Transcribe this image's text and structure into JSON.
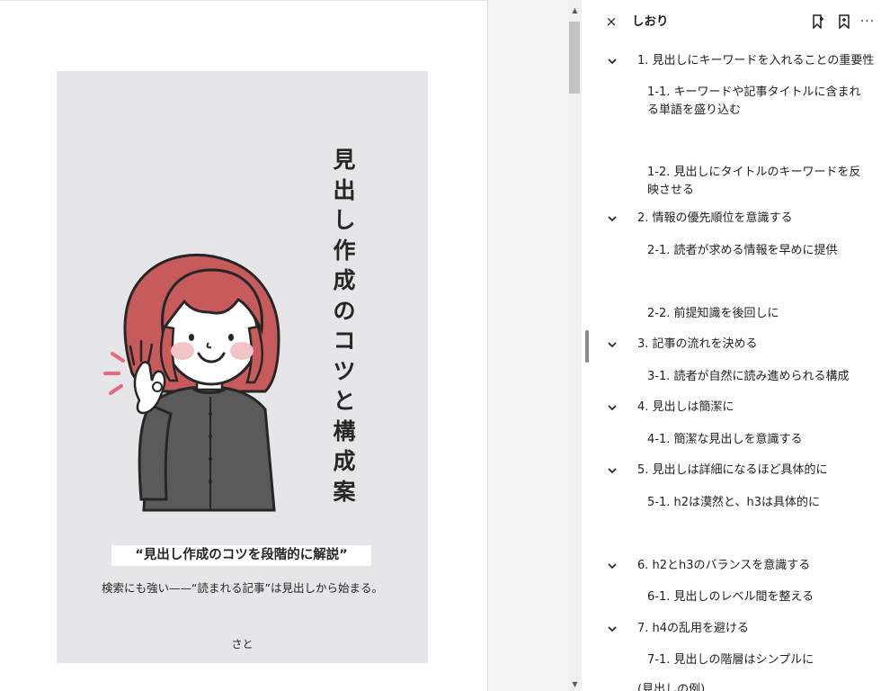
{
  "cover": {
    "title_chars": [
      "見",
      "出",
      "し",
      "作",
      "成",
      "の",
      "コ",
      "ツ",
      "と",
      "構",
      "成",
      "案"
    ],
    "subtitle": "“見出し作成のコツを段階的に解説”",
    "tagline": "検索にも強い——“読まれる記事”は見出しから始まる。",
    "author": "さと"
  },
  "panel": {
    "title": "しおり",
    "close_glyph": "×",
    "more_glyph": "···"
  },
  "bookmarks": [
    {
      "level": 1,
      "label": "1. 見出しにキーワードを入れることの重要性",
      "expanded": true
    },
    {
      "level": 2,
      "label": "1-1. キーワードや記事タイトルに含まれる単語を盛り込む"
    },
    {
      "level": 2,
      "label": "1-2. 見出しにタイトルのキーワードを反映させる"
    },
    {
      "level": 1,
      "label": "2. 情報の優先順位を意識する",
      "expanded": true
    },
    {
      "level": 2,
      "label": "2-1. 読者が求める情報を早めに提供"
    },
    {
      "level": 2,
      "label": "2-2. 前提知識を後回しに"
    },
    {
      "level": 1,
      "label": "3. 記事の流れを決める",
      "expanded": true
    },
    {
      "level": 2,
      "label": "3-1. 読者が自然に読み進められる構成"
    },
    {
      "level": 1,
      "label": "4. 見出しは簡潔に",
      "expanded": true
    },
    {
      "level": 2,
      "label": "4-1. 簡潔な見出しを意識する"
    },
    {
      "level": 1,
      "label": "5. 見出しは詳細になるほど具体的に",
      "expanded": true
    },
    {
      "level": 2,
      "label": "5-1. h2は漠然と、h3は具体的に"
    },
    {
      "level": 1,
      "label": "6. h2とh3のバランスを意識する",
      "expanded": true
    },
    {
      "level": 2,
      "label": "6-1. 見出しのレベル間を整える"
    },
    {
      "level": 1,
      "label": "7. h4の乱用を避ける",
      "expanded": true
    },
    {
      "level": 2,
      "label": "7-1. 見出しの階層はシンプルに"
    },
    {
      "level": 1,
      "label": "(見出しの例)"
    }
  ],
  "colors": {
    "page_bg": "#e6e6e8",
    "hair": "#c75a5a",
    "sweater": "#5a5a5a",
    "blush": "#f2c4c8",
    "accent_pink": "#e9667e"
  }
}
